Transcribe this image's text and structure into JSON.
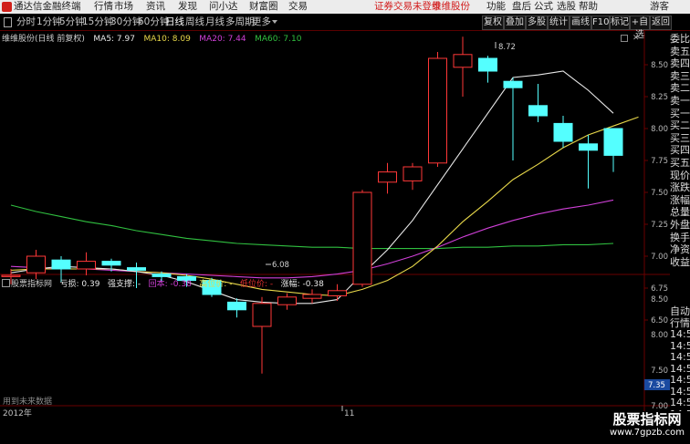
{
  "menu": {
    "app_title": "通达信金融终端",
    "items": [
      "行情",
      "市场",
      "资讯",
      "发现",
      "问小达",
      "财富圈",
      "交易"
    ],
    "notice": "证券交易未登录",
    "stock_badge": "维维股份",
    "right_items": [
      "功能",
      "盘后",
      "公式",
      "选股",
      "帮助"
    ],
    "guest": "游客"
  },
  "toolbar": {
    "periods": [
      "分时",
      "1分钟",
      "5分钟",
      "15分钟",
      "30分钟",
      "60分钟",
      "日线",
      "周线",
      "月线",
      "多周期",
      "更多"
    ],
    "active_period": "日线",
    "right_buttons": [
      "复权",
      "叠加",
      "多股",
      "统计",
      "画线",
      "F10",
      "标记",
      "+自选",
      "返回"
    ]
  },
  "main_chart": {
    "title": "维维股份(日线 前复权)",
    "ma_labels": [
      {
        "text": "MA5: 7.97",
        "color": "#e8e8e8"
      },
      {
        "text": "MA10: 8.09",
        "color": "#e8d84a"
      },
      {
        "text": "MA20: 7.44",
        "color": "#d040d8"
      },
      {
        "text": "MA60: 7.10",
        "color": "#30c040"
      }
    ],
    "price_axis": [
      "8.50",
      "8.25",
      "8.00",
      "7.75",
      "7.50",
      "7.25",
      "7.00",
      "6.75",
      "6.50"
    ],
    "high_label": "8.72",
    "low_label": "6.08"
  },
  "indicator": {
    "name": "股票指标网",
    "labels": [
      {
        "text": "亏损: 0.39",
        "color": "#e8e8e8"
      },
      {
        "text": "强支撑: -",
        "color": "#e8e8e8"
      },
      {
        "text": "回本: -0.38",
        "color": "#d040d8"
      },
      {
        "text": "高位价: -",
        "color": "#e8d84a"
      },
      {
        "text": "低位价: -",
        "color": "#e83030"
      },
      {
        "text": "涨幅: -0.38",
        "color": "#e8e8e8"
      }
    ],
    "axis": [
      "8.50",
      "8.00",
      "7.50",
      "7.00"
    ],
    "current_value": "7.35"
  },
  "footer": {
    "no_data": "用到未来数据",
    "year_label": "2012年",
    "month_label": "11"
  },
  "side_panel": {
    "items": [
      "委比",
      "卖五",
      "卖四",
      "卖三",
      "卖二",
      "卖一",
      "买一",
      "买二",
      "买三",
      "买四",
      "买五",
      "现价",
      "涨跌",
      "涨幅",
      "总量",
      "外盘",
      "换手",
      "净资",
      "收益"
    ],
    "lower_items": [
      "自动",
      "行情",
      "14:5",
      "14:5",
      "14:5",
      "14:5",
      "14:5",
      "14:5",
      "14:5",
      "14:5",
      "14:5",
      "14:5"
    ]
  },
  "watermark": {
    "title": "股票指标网",
    "url": "www.7gpzb.com"
  },
  "colors": {
    "up": "#ff3838",
    "down": "#54ffff",
    "ma5": "#e8e8e8",
    "ma10": "#e8d84a",
    "ma20": "#d040d8",
    "ma60": "#30c040",
    "grid": "#6a0000"
  },
  "candles": [
    {
      "o": 6.84,
      "c": 6.85,
      "h": 6.9,
      "l": 6.78
    },
    {
      "o": 6.87,
      "c": 7.0,
      "h": 7.05,
      "l": 6.82
    },
    {
      "o": 6.97,
      "c": 6.9,
      "h": 7.0,
      "l": 6.8
    },
    {
      "o": 6.9,
      "c": 6.96,
      "h": 7.03,
      "l": 6.85
    },
    {
      "o": 6.96,
      "c": 6.93,
      "h": 6.98,
      "l": 6.88
    },
    {
      "o": 6.91,
      "c": 6.89,
      "h": 6.95,
      "l": 6.75
    },
    {
      "o": 6.86,
      "c": 6.84,
      "h": 6.88,
      "l": 6.8
    },
    {
      "o": 6.84,
      "c": 6.81,
      "h": 6.86,
      "l": 6.76
    },
    {
      "o": 6.81,
      "c": 6.7,
      "h": 6.83,
      "l": 6.68
    },
    {
      "o": 6.64,
      "c": 6.58,
      "h": 6.67,
      "l": 6.52
    },
    {
      "o": 6.45,
      "c": 6.63,
      "h": 6.68,
      "l": 6.08
    },
    {
      "o": 6.62,
      "c": 6.68,
      "h": 6.71,
      "l": 6.58
    },
    {
      "o": 6.67,
      "c": 6.7,
      "h": 6.74,
      "l": 6.63
    },
    {
      "o": 6.69,
      "c": 6.73,
      "h": 6.78,
      "l": 6.65
    },
    {
      "o": 6.78,
      "c": 7.5,
      "h": 7.52,
      "l": 6.76
    },
    {
      "o": 7.58,
      "c": 7.66,
      "h": 7.73,
      "l": 7.49
    },
    {
      "o": 7.59,
      "c": 7.7,
      "h": 7.73,
      "l": 7.52
    },
    {
      "o": 7.73,
      "c": 8.55,
      "h": 8.6,
      "l": 7.7
    },
    {
      "o": 8.48,
      "c": 8.58,
      "h": 8.72,
      "l": 8.25
    },
    {
      "o": 8.55,
      "c": 8.45,
      "h": 8.57,
      "l": 8.36
    },
    {
      "o": 8.37,
      "c": 8.32,
      "h": 8.4,
      "l": 7.75
    },
    {
      "o": 8.18,
      "c": 8.1,
      "h": 8.35,
      "l": 8.05
    },
    {
      "o": 8.04,
      "c": 7.9,
      "h": 8.1,
      "l": 7.85
    },
    {
      "o": 7.88,
      "c": 7.83,
      "h": 7.95,
      "l": 7.53
    },
    {
      "o": 8.0,
      "c": 7.79,
      "h": 8.0,
      "l": 7.66
    }
  ],
  "ma_series": {
    "ma5": [
      6.87,
      6.9,
      6.92,
      6.91,
      6.9,
      6.88,
      6.85,
      6.8,
      6.73,
      6.66,
      6.64,
      6.63,
      6.63,
      6.66,
      6.86,
      7.05,
      7.28,
      7.56,
      7.84,
      8.12,
      8.4,
      8.42,
      8.45,
      8.3,
      8.12
    ],
    "ma10": [
      6.89,
      6.9,
      6.9,
      6.9,
      6.9,
      6.88,
      6.87,
      6.85,
      6.82,
      6.78,
      6.74,
      6.72,
      6.7,
      6.69,
      6.74,
      6.81,
      6.92,
      7.08,
      7.27,
      7.43,
      7.6,
      7.72,
      7.85,
      7.95,
      8.02,
      8.09
    ],
    "ma20": [
      6.92,
      6.91,
      6.9,
      6.9,
      6.89,
      6.88,
      6.87,
      6.86,
      6.85,
      6.84,
      6.83,
      6.83,
      6.84,
      6.86,
      6.89,
      6.94,
      7.0,
      7.07,
      7.15,
      7.22,
      7.28,
      7.33,
      7.37,
      7.4,
      7.44
    ],
    "ma60": [
      7.4,
      7.35,
      7.31,
      7.27,
      7.24,
      7.2,
      7.17,
      7.14,
      7.12,
      7.1,
      7.09,
      7.08,
      7.07,
      7.07,
      7.06,
      7.06,
      7.06,
      7.06,
      7.07,
      7.07,
      7.08,
      7.08,
      7.09,
      7.09,
      7.1
    ]
  }
}
